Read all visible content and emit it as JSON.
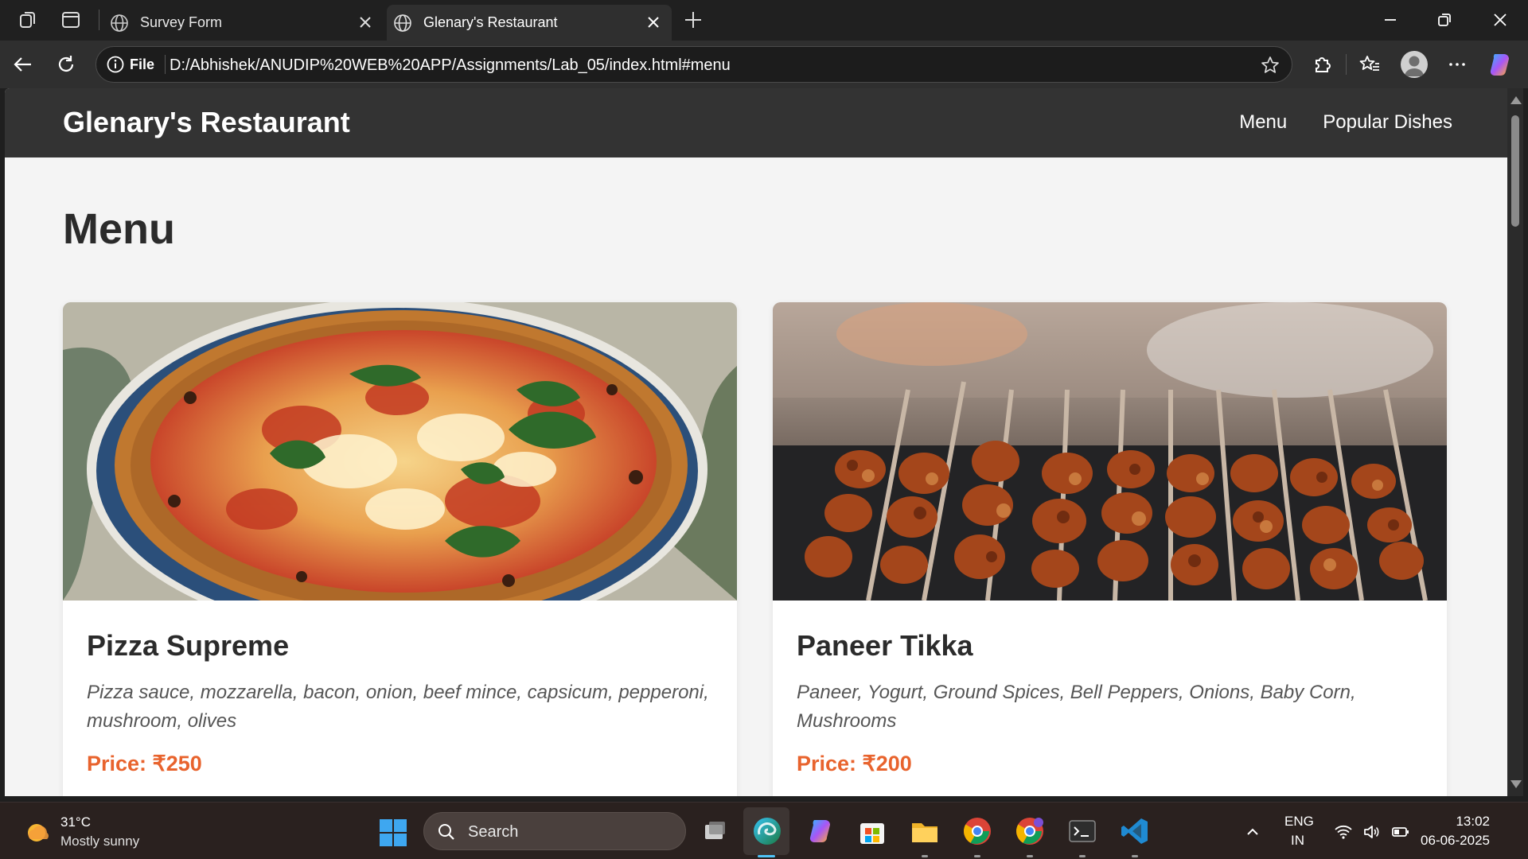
{
  "browser": {
    "tabs": [
      {
        "title": "Survey Form",
        "active": false
      },
      {
        "title": "Glenary's Restaurant",
        "active": true
      }
    ],
    "address": {
      "scheme_label": "File",
      "url": "D:/Abhishek/ANUDIP%20WEB%20APP/Assignments/Lab_05/index.html#menu"
    }
  },
  "site": {
    "brand": "Glenary's Restaurant",
    "nav": [
      {
        "label": "Menu"
      },
      {
        "label": "Popular Dishes"
      }
    ],
    "section_title": "Menu",
    "items": [
      {
        "name": "Pizza Supreme",
        "description": "Pizza sauce, mozzarella, bacon, onion, beef mince, capsicum, pepperoni, mushroom, olives",
        "price": "Price: ₹250",
        "image": "pizza-photo"
      },
      {
        "name": "Paneer Tikka",
        "description": "Paneer, Yogurt, Ground Spices, Bell Peppers, Onions, Baby Corn, Mushrooms",
        "price": "Price: ₹200",
        "image": "paneer-tikka-photo"
      }
    ],
    "colors": {
      "header_bg": "#333333",
      "page_bg": "#f4f4f4",
      "price": "#e8632d"
    }
  },
  "taskbar": {
    "weather": {
      "temp": "31°C",
      "condition": "Mostly sunny"
    },
    "search_placeholder": "Search",
    "language": {
      "line1": "ENG",
      "line2": "IN"
    },
    "time": "13:02",
    "date": "06-06-2025"
  }
}
